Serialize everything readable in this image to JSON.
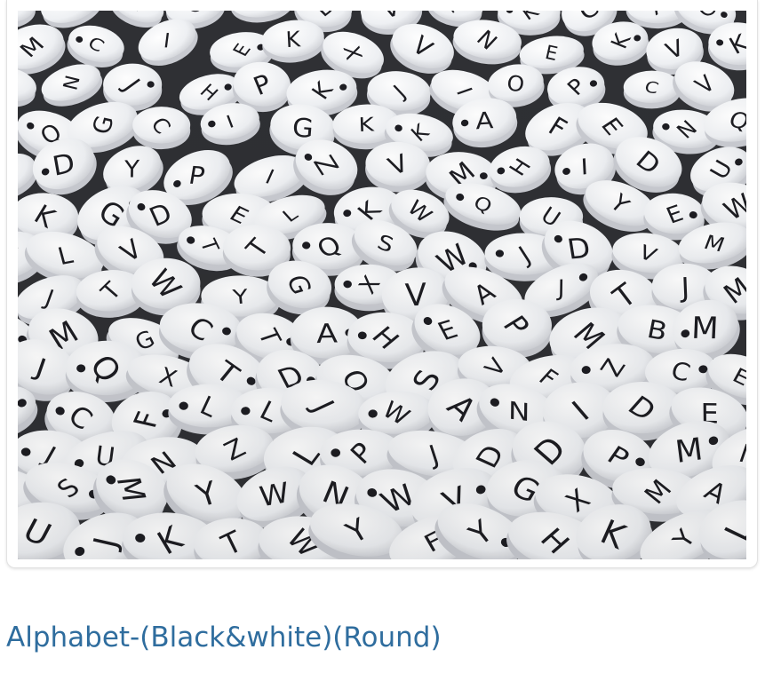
{
  "product": {
    "title": "Alphabet-(Black&white)(Round)",
    "image_subject": "round-white-alphabet-beads-photo",
    "colors": {
      "title": "#2f6d9e",
      "bead": "#f3f3f5",
      "bead_shade": "#d9dadf",
      "letter": "#1d1d22",
      "background": "#2f3034"
    }
  }
}
